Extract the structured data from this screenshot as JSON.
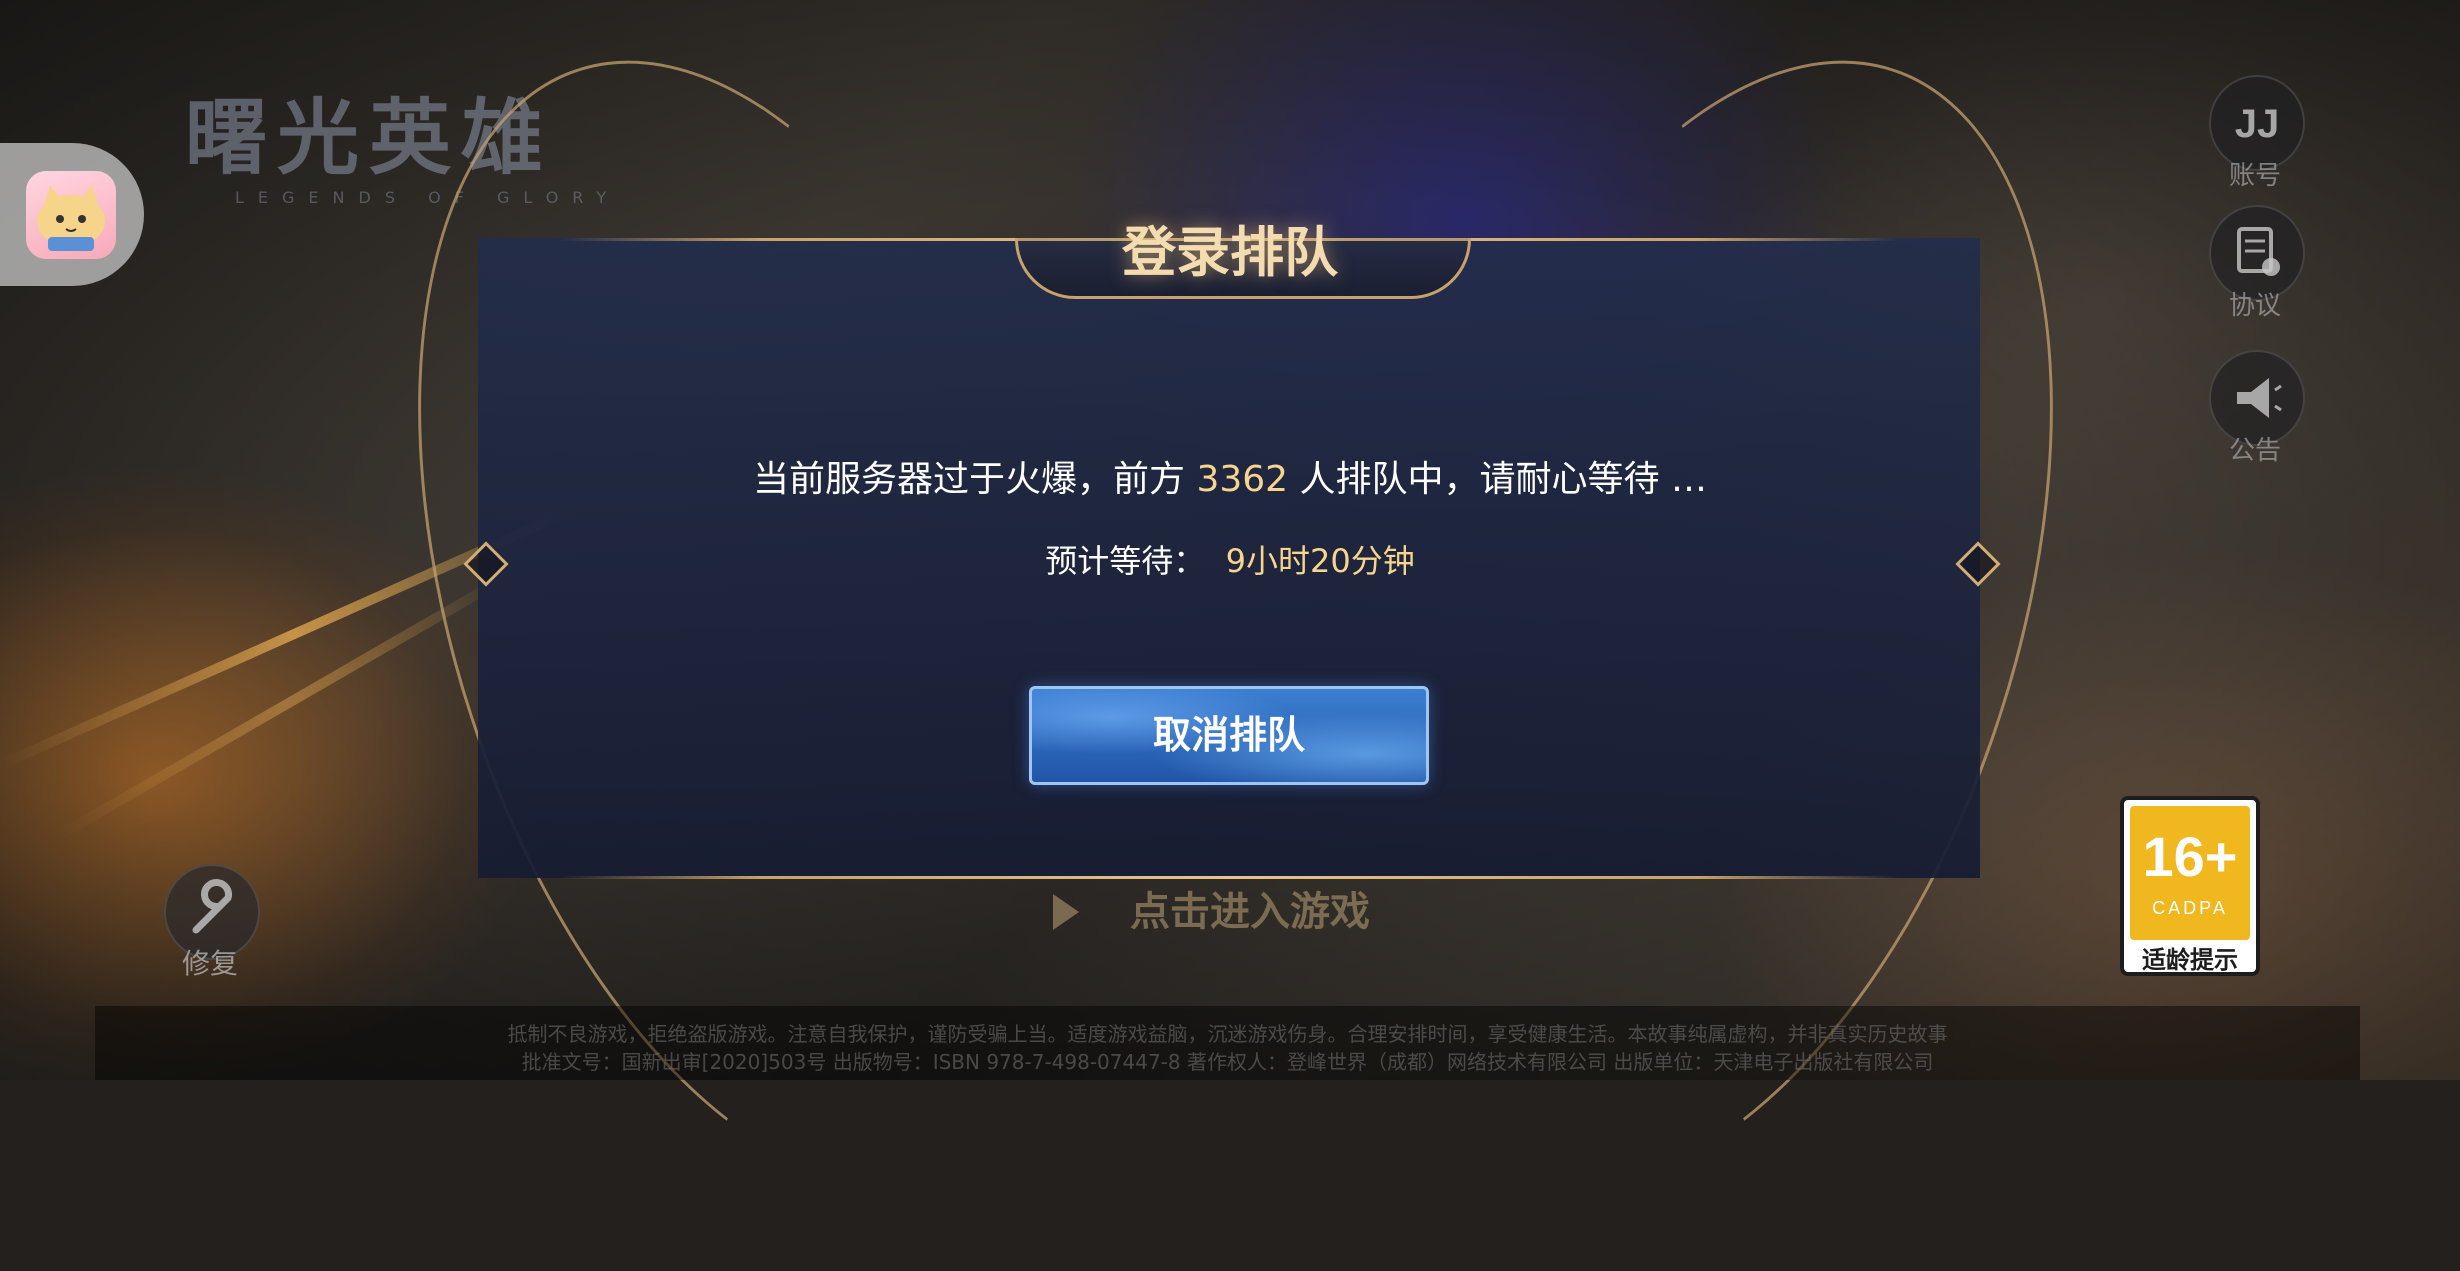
{
  "logo": {
    "title": "曙光英雄",
    "subtitle": "LEGENDS OF GLORY"
  },
  "side_buttons": [
    {
      "label": "账号",
      "icon": "account-icon"
    },
    {
      "label": "协议",
      "icon": "agreement-icon"
    },
    {
      "label": "公告",
      "icon": "announcement-icon"
    }
  ],
  "dialog": {
    "title": "登录排队",
    "message_before": "当前服务器过于火爆，前方 ",
    "queue_count": "3362",
    "message_after": " 人排队中，请耐心等待 …",
    "eta_label": "预计等待：",
    "eta_value": "9小时20分钟",
    "cancel_label": "取消排队"
  },
  "enter_game": "点击进入游戏",
  "repair": {
    "label": "修复",
    "icon": "wrench-icon"
  },
  "age_rating": {
    "number": "16+",
    "org": "CADPA",
    "label": "适龄提示",
    "color": "#f1b71f"
  },
  "footer": {
    "line1": "抵制不良游戏，拒绝盗版游戏。注意自我保护，谨防受骗上当。适度游戏益脑，沉迷游戏伤身。合理安排时间，享受健康生活。本故事纯属虚构，并非真实历史故事",
    "line2": "批准文号：国新出审[2020]503号 出版物号：ISBN 978-7-498-07447-8 著作权人：登峰世界（成都）网络技术有限公司 出版单位：天津电子出版社有限公司"
  },
  "colors": {
    "gold": "#c8a26a",
    "highlight": "#f7d58e",
    "button_blue": "#2f6cc0"
  }
}
